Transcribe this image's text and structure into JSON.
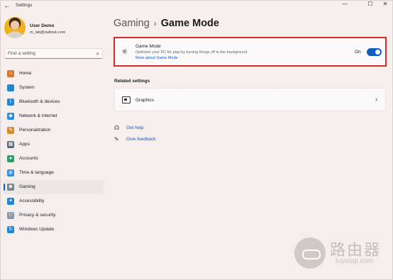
{
  "window": {
    "title": "Settings",
    "back_glyph": "←",
    "min_glyph": "—",
    "max_glyph": "☐",
    "close_glyph": "✕"
  },
  "user": {
    "name": "User Demo",
    "email": "m_lab@outlook.com"
  },
  "search": {
    "placeholder": "Find a setting",
    "icon": "search-icon"
  },
  "sidebar": {
    "items": [
      {
        "label": "Home",
        "icon": "home-icon",
        "color": "#d9762b",
        "glyph": "⌂",
        "active": false
      },
      {
        "label": "System",
        "icon": "monitor-icon",
        "color": "#1f86d6",
        "glyph": "",
        "active": false
      },
      {
        "label": "Bluetooth & devices",
        "icon": "bluetooth-icon",
        "color": "#1f86d6",
        "glyph": "ᛒ",
        "active": false
      },
      {
        "label": "Network & internet",
        "icon": "wifi-icon",
        "color": "#2b8fd9",
        "glyph": "◆",
        "active": false
      },
      {
        "label": "Personalization",
        "icon": "brush-icon",
        "color": "#d98a2b",
        "glyph": "✎",
        "active": false
      },
      {
        "label": "Apps",
        "icon": "apps-icon",
        "color": "#5b6b7c",
        "glyph": "▦",
        "active": false
      },
      {
        "label": "Accounts",
        "icon": "person-icon",
        "color": "#2e9e6a",
        "glyph": "●",
        "active": false
      },
      {
        "label": "Time & language",
        "icon": "globe-icon",
        "color": "#2b8fd9",
        "glyph": "◍",
        "active": false
      },
      {
        "label": "Gaming",
        "icon": "controller-icon",
        "color": "#7a8692",
        "glyph": "◙",
        "active": true
      },
      {
        "label": "Accessibility",
        "icon": "accessibility-icon",
        "color": "#1f86d6",
        "glyph": "✦",
        "active": false
      },
      {
        "label": "Privacy & security",
        "icon": "shield-icon",
        "color": "#8a96a3",
        "glyph": "⛉",
        "active": false
      },
      {
        "label": "Windows Update",
        "icon": "update-icon",
        "color": "#1f86d6",
        "glyph": "↻",
        "active": false
      }
    ]
  },
  "breadcrumb": {
    "parent": "Gaming",
    "separator": "›",
    "current": "Game Mode"
  },
  "game_mode": {
    "title": "Game Mode",
    "description": "Optimize your PC for play by turning things off in the background",
    "link": "More about Game Mode",
    "state_label": "On",
    "enabled": true
  },
  "related": {
    "heading": "Related settings",
    "graphics_label": "Graphics",
    "chevron": "›"
  },
  "help": {
    "get_help": "Get help",
    "give_feedback": "Give feedback"
  },
  "watermark": {
    "cn": "路由器",
    "url": "luyouqi.com"
  },
  "colors": {
    "accent": "#0f5fc1",
    "highlight": "#d62b2b"
  }
}
